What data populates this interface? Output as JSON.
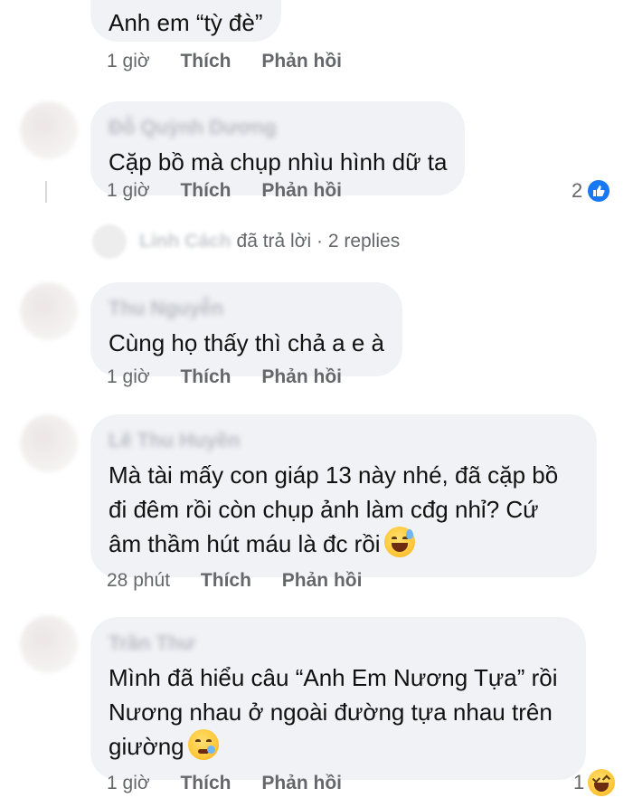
{
  "comments": [
    {
      "author": "",
      "text": "Anh em “tỳ đè”",
      "time": "1 giờ",
      "like": "Thích",
      "reply": "Phản hồi"
    },
    {
      "author": "Đỗ Quỳnh Dương",
      "text": "Cặp bồ mà chụp nhìu hình dữ ta",
      "time": "1 giờ",
      "like": "Thích",
      "reply": "Phản hồi",
      "reaction_count": "2",
      "reaction_icon": "like-icon",
      "replies": {
        "replier": "Linh Cách",
        "text": "đã trả lời · 2 replies"
      }
    },
    {
      "author": "Thu Nguyễn",
      "text": "Cùng họ thấy thì chả a e à",
      "time": "1 giờ",
      "like": "Thích",
      "reply": "Phản hồi"
    },
    {
      "author": "Lê Thu Huyền",
      "line1": "Mà tài mấy con giáp 13 này nhé, đã cặp bồ",
      "line2": "đi đêm rồi còn chụp ảnh làm cđg nhỉ? Cứ",
      "line3": "âm thầm hút máu là đc rồi",
      "emoji": "grinning-sweat-emoji",
      "time": "28 phút",
      "like": "Thích",
      "reply": "Phản hồi"
    },
    {
      "author": "Trần Thư",
      "line1": "Mình đã hiểu câu “Anh Em Nương Tựa” rồi",
      "line2": "Nương nhau ở ngoài đường tựa nhau trên",
      "line3": "giường",
      "emoji": "sleepy-emoji",
      "time": "1 giờ",
      "like": "Thích",
      "reply": "Phản hồi",
      "reaction_count": "1",
      "reaction_icon": "haha-icon"
    }
  ],
  "colors": {
    "bubble": "#f0f2f5",
    "meta_text": "#65676b",
    "like_blue": "#1877f2"
  }
}
